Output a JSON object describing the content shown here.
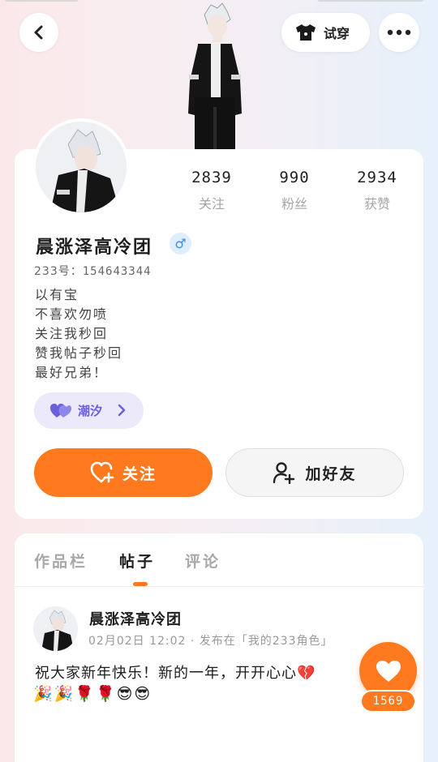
{
  "header": {
    "try_on_label": "试穿"
  },
  "profile": {
    "stats": [
      {
        "value": "2839",
        "label": "关注"
      },
      {
        "value": "990",
        "label": "粉丝"
      },
      {
        "value": "2934",
        "label": "获赞"
      }
    ],
    "nickname": "晨涨泽高冷团",
    "gender_symbol": "♂",
    "uid_label": "233号：",
    "uid": "154643344",
    "bio_lines": [
      "以有宝",
      "不喜欢勿喷",
      "关注我秒回",
      "赞我帖子秒回",
      "最好兄弟！"
    ],
    "tag_label": "潮汐",
    "follow_label": "关注",
    "add_friend_label": "加好友"
  },
  "tabs": [
    {
      "label": "作品栏"
    },
    {
      "label": "帖子"
    },
    {
      "label": "评论"
    }
  ],
  "active_tab_index": 1,
  "post": {
    "author": "晨涨泽高冷团",
    "meta": "02月02日 12:02 · 发布在「我的233角色」",
    "text": "祝大家新年快乐！新的一年，开开心心💔",
    "emojis": "🎉🎉🌹🌹😎😎",
    "likes": "1569"
  },
  "colors": {
    "accent": "#ff7a1f",
    "tag_purple": "#6a5fdb",
    "gender_blue": "#3b8ee6"
  }
}
